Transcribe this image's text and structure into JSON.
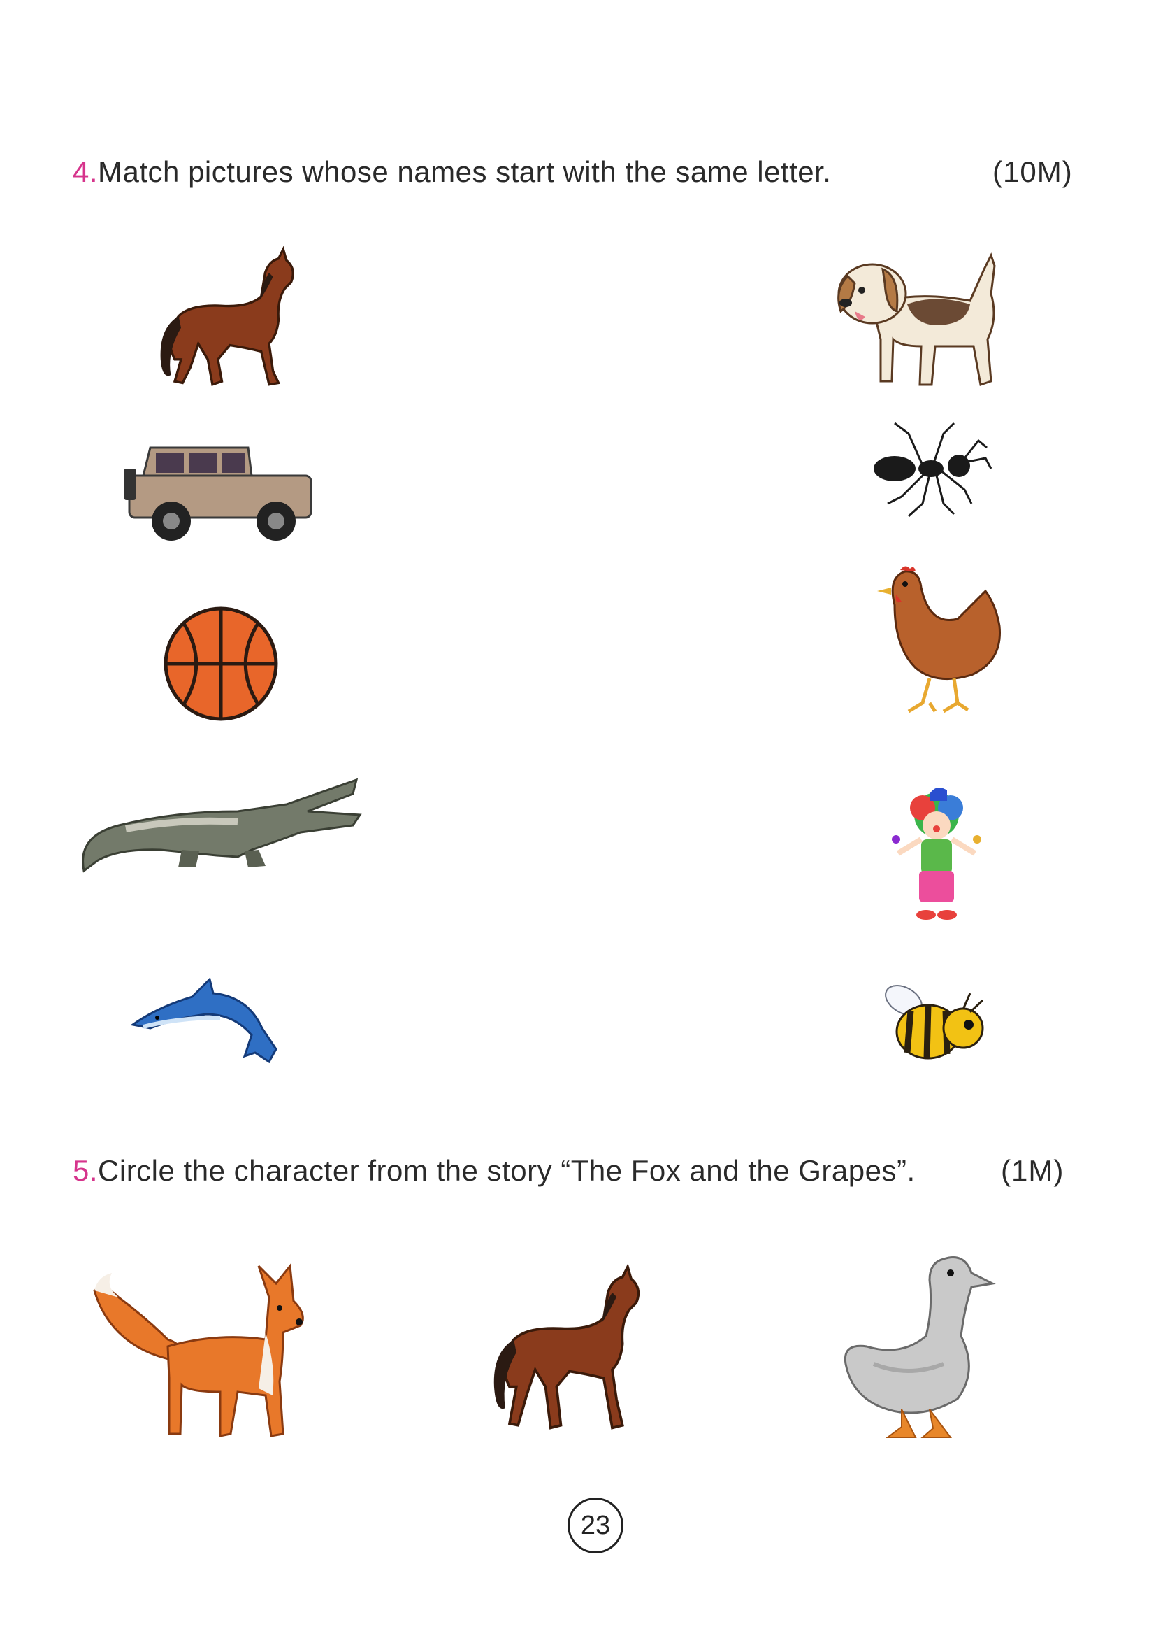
{
  "question4": {
    "number": "4.",
    "text": "Match pictures whose names start with the same letter.",
    "marks": "(10M)"
  },
  "question5": {
    "number": "5.",
    "text": "Circle the character from the story “The Fox and the Grapes”.",
    "marks": "(1M)"
  },
  "left_column_pictures": [
    "horse-icon",
    "jeep-icon",
    "basketball-icon",
    "crocodile-icon",
    "dolphin-icon"
  ],
  "right_column_pictures": [
    "dog-icon",
    "ant-icon",
    "hen-icon",
    "clown-icon",
    "bee-icon"
  ],
  "q5_pictures": [
    "fox-icon",
    "horse-icon",
    "duck-icon"
  ],
  "colors": {
    "question_number": "#d6348c",
    "text": "#2a2a2a"
  },
  "page_number": "23"
}
